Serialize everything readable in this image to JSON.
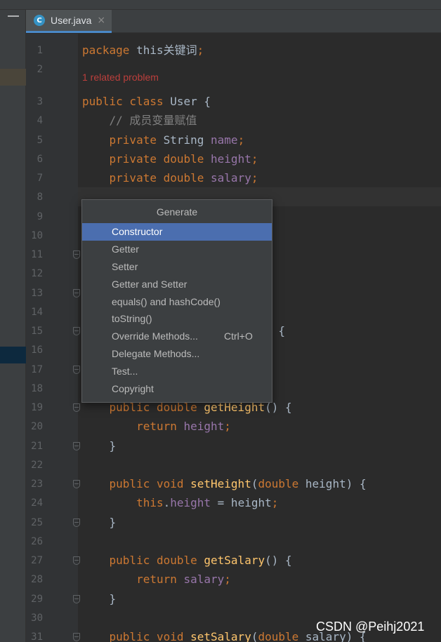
{
  "tab": {
    "icon_letter": "C",
    "title": "User.java",
    "close": "×"
  },
  "problem_hint": "1 related problem",
  "code_lines": [
    {
      "n": "1",
      "tokens": [
        [
          "kw",
          "package "
        ],
        [
          "",
          "this"
        ],
        [
          "",
          "关键词"
        ],
        [
          "kw",
          ";"
        ]
      ]
    },
    {
      "n": "2",
      "tokens": []
    },
    {
      "n": "3",
      "tokens": [
        [
          "kw",
          "public class "
        ],
        [
          "",
          "User {"
        ]
      ]
    },
    {
      "n": "4",
      "tokens": [
        [
          "cmt",
          "    // 成员变量赋值"
        ]
      ]
    },
    {
      "n": "5",
      "tokens": [
        [
          "kw",
          "    private "
        ],
        [
          "",
          "String "
        ],
        [
          "fld",
          "name"
        ],
        [
          "kw",
          ";"
        ]
      ]
    },
    {
      "n": "6",
      "tokens": [
        [
          "kw",
          "    private double "
        ],
        [
          "fld",
          "height"
        ],
        [
          "kw",
          ";"
        ]
      ]
    },
    {
      "n": "7",
      "tokens": [
        [
          "kw",
          "    private double "
        ],
        [
          "fld",
          "salary"
        ],
        [
          "kw",
          ";"
        ]
      ]
    },
    {
      "n": "8",
      "tokens": []
    },
    {
      "n": "9",
      "tokens": [
        [
          "",
          "                     {"
        ]
      ]
    },
    {
      "n": "10",
      "tokens": [
        [
          "",
          "                     }"
        ]
      ]
    },
    {
      "n": "11",
      "tokens": [
        [
          "",
          "                     ) {"
        ]
      ]
    },
    {
      "n": "12",
      "tokens": [
        [
          "",
          "                     }"
        ]
      ]
    },
    {
      "n": "13",
      "tokens": [
        [
          "",
          "                     }"
        ]
      ]
    },
    {
      "n": "14",
      "tokens": [
        [
          "",
          "                     }"
        ]
      ]
    },
    {
      "n": "15",
      "tokens": [
        [
          "",
          "                   ing name) {"
        ]
      ]
    },
    {
      "n": "16",
      "tokens": []
    },
    {
      "n": "17",
      "tokens": []
    },
    {
      "n": "18",
      "tokens": []
    },
    {
      "n": "19",
      "tokens": [
        [
          "kw",
          "    public double "
        ],
        [
          "fn",
          "getHeight"
        ],
        [
          "",
          "() {"
        ]
      ]
    },
    {
      "n": "20",
      "tokens": [
        [
          "kw",
          "        return "
        ],
        [
          "fld",
          "height"
        ],
        [
          "kw",
          ";"
        ]
      ]
    },
    {
      "n": "21",
      "tokens": [
        [
          "",
          "    }"
        ]
      ]
    },
    {
      "n": "22",
      "tokens": []
    },
    {
      "n": "23",
      "tokens": [
        [
          "kw",
          "    public void "
        ],
        [
          "fn",
          "setHeight"
        ],
        [
          "",
          "("
        ],
        [
          "kw",
          "double "
        ],
        [
          "",
          "height) {"
        ]
      ]
    },
    {
      "n": "24",
      "tokens": [
        [
          "kw",
          "        this"
        ],
        [
          "",
          "."
        ],
        [
          "fld",
          "height"
        ],
        [
          "",
          " = height"
        ],
        [
          "kw",
          ";"
        ]
      ]
    },
    {
      "n": "25",
      "tokens": [
        [
          "",
          "    }"
        ]
      ]
    },
    {
      "n": "26",
      "tokens": []
    },
    {
      "n": "27",
      "tokens": [
        [
          "kw",
          "    public double "
        ],
        [
          "fn",
          "getSalary"
        ],
        [
          "",
          "() {"
        ]
      ]
    },
    {
      "n": "28",
      "tokens": [
        [
          "kw",
          "        return "
        ],
        [
          "fld",
          "salary"
        ],
        [
          "kw",
          ";"
        ]
      ]
    },
    {
      "n": "29",
      "tokens": [
        [
          "",
          "    }"
        ]
      ]
    },
    {
      "n": "30",
      "tokens": []
    },
    {
      "n": "31",
      "tokens": [
        [
          "kw",
          "    public void "
        ],
        [
          "fn",
          "setSalary"
        ],
        [
          "",
          "("
        ],
        [
          "kw",
          "double "
        ],
        [
          "",
          "salary) {"
        ]
      ]
    }
  ],
  "generate_menu": {
    "title": "Generate",
    "items": [
      {
        "label": "Constructor",
        "shortcut": "",
        "selected": true
      },
      {
        "label": "Getter",
        "shortcut": "",
        "selected": false
      },
      {
        "label": "Setter",
        "shortcut": "",
        "selected": false
      },
      {
        "label": "Getter and Setter",
        "shortcut": "",
        "selected": false
      },
      {
        "label": "equals() and hashCode()",
        "shortcut": "",
        "selected": false
      },
      {
        "label": "toString()",
        "shortcut": "",
        "selected": false
      },
      {
        "label": "Override Methods...",
        "shortcut": "Ctrl+O",
        "selected": false
      },
      {
        "label": "Delegate Methods...",
        "shortcut": "",
        "selected": false
      },
      {
        "label": "Test...",
        "shortcut": "",
        "selected": false
      },
      {
        "label": "Copyright",
        "shortcut": "",
        "selected": false
      }
    ]
  },
  "watermark": "CSDN @Peihj2021",
  "colors": {
    "background": "#2b2b2b",
    "keyword": "#cc7832",
    "field": "#9876aa",
    "method": "#ffc66d",
    "comment": "#808080",
    "selection": "#4b6eaf",
    "error": "#bc3f3c"
  }
}
